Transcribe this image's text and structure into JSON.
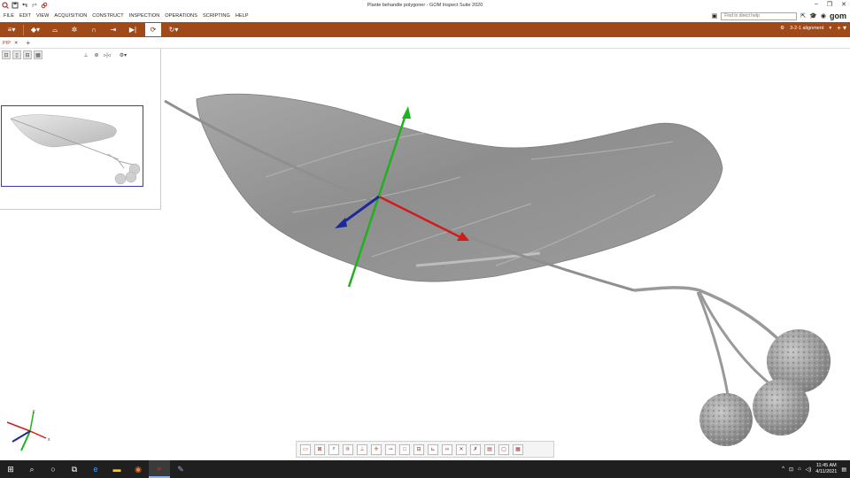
{
  "window": {
    "title": "Plante behandle polygoner - GOM Inspect Suite 2020"
  },
  "menu": {
    "items": [
      "FILE",
      "EDIT",
      "VIEW",
      "ACQUISITION",
      "CONSTRUCT",
      "INSPECTION",
      "OPERATIONS",
      "SCRIPTING",
      "HELP"
    ],
    "search_placeholder": "Find in direct help",
    "logo": "gom"
  },
  "toolbar": {
    "alignment_label": "3-2-1 alignment"
  },
  "tabs": [
    {
      "label": "PIP"
    }
  ],
  "taskbar": {
    "time": "11:45 AM",
    "date": "4/11/2021"
  },
  "colors": {
    "toolbar": "#a04a1a",
    "axis_x": "#d21c1c",
    "axis_y": "#21b021",
    "axis_z": "#1a2a9a",
    "mesh": "#9d9d9d"
  }
}
